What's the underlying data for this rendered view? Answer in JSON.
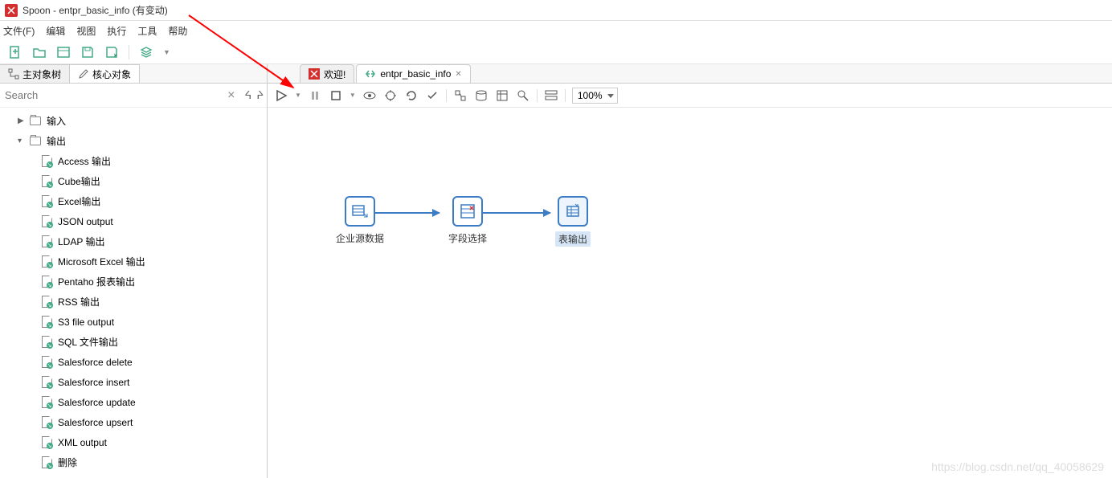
{
  "window": {
    "title": "Spoon - entpr_basic_info (有变动)"
  },
  "menu": [
    "文件(F)",
    "编辑",
    "视图",
    "执行",
    "工具",
    "帮助"
  ],
  "sidebar": {
    "tabs": [
      {
        "label": "主对象树",
        "icon": "tree-icon"
      },
      {
        "label": "核心对象",
        "icon": "pencil-icon"
      }
    ],
    "search_placeholder": "Search",
    "tree": {
      "input": {
        "label": "输入",
        "expanded": false
      },
      "output": {
        "label": "输出",
        "expanded": true,
        "children": [
          "Access 输出",
          "Cube输出",
          "Excel输出",
          "JSON output",
          "LDAP 输出",
          "Microsoft Excel 输出",
          "Pentaho 报表输出",
          "RSS 输出",
          "S3 file output",
          "SQL 文件输出",
          "Salesforce delete",
          "Salesforce insert",
          "Salesforce update",
          "Salesforce upsert",
          "XML output",
          "删除"
        ]
      }
    }
  },
  "content_tabs": [
    {
      "label": "欢迎!",
      "icon": "welcome-icon",
      "closable": false
    },
    {
      "label": "entpr_basic_info",
      "icon": "transform-icon",
      "closable": true
    }
  ],
  "zoom": "100%",
  "steps": [
    {
      "id": "s1",
      "label": "企业源数据"
    },
    {
      "id": "s2",
      "label": "字段选择"
    },
    {
      "id": "s3",
      "label": "表输出",
      "selected": true
    }
  ],
  "watermark": "https://blog.csdn.net/qq_40058629"
}
